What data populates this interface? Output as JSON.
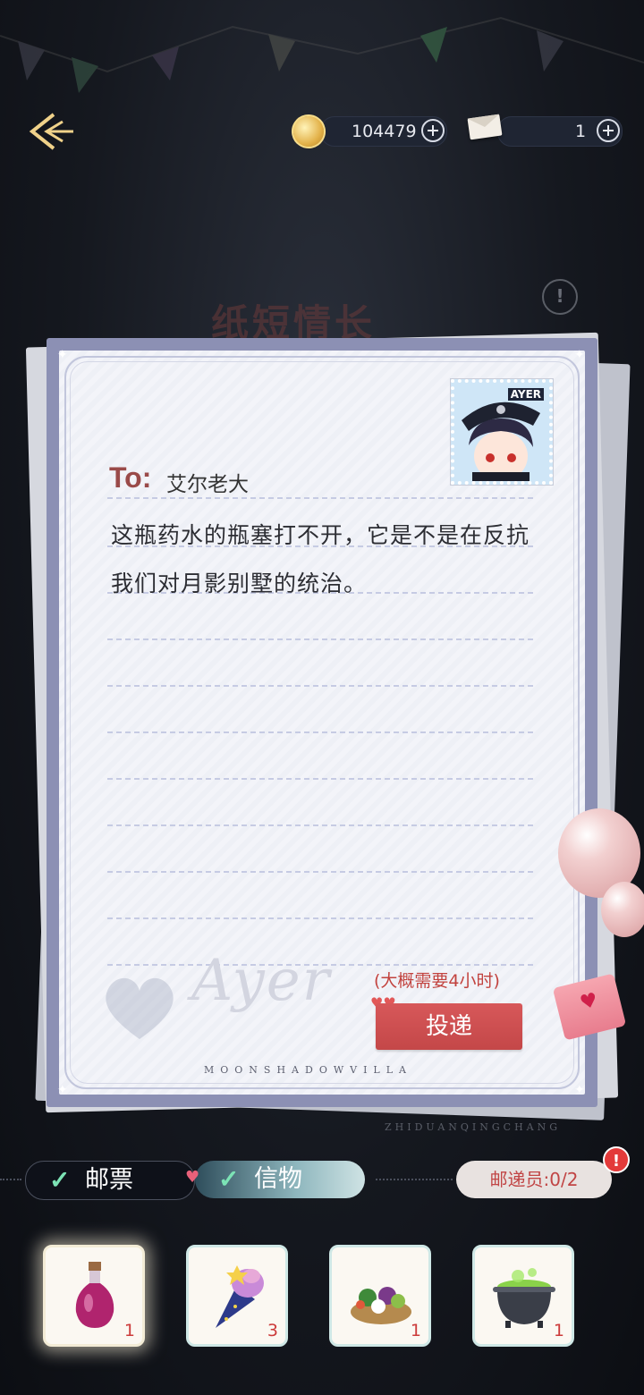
{
  "header": {
    "coins": "104479",
    "letters": "1"
  },
  "background": {
    "banner_title": "纸短情长",
    "subtitle": "ZHIDUANQINGCHANG"
  },
  "letter": {
    "to_label": "To:",
    "recipient": "艾尔老大",
    "body_line1": "这瓶药水的瓶塞打不开，它是不是在反抗",
    "body_line2": "我们对月影别墅的统治。",
    "stamp_label": "AYER",
    "signature": "Ayer",
    "eta": "(大概需要4小时)",
    "send_label": "投递",
    "footer": "MOONSHADOWVILLA"
  },
  "tabs": {
    "stamp_label": "邮票",
    "gift_label": "信物"
  },
  "courier": {
    "label": "邮递员:0/2",
    "badge": "!"
  },
  "items": [
    {
      "name": "potion",
      "qty": "1"
    },
    {
      "name": "ice-cream-cone",
      "qty": "3"
    },
    {
      "name": "vegetable-plate",
      "qty": "1"
    },
    {
      "name": "cauldron",
      "qty": "1"
    }
  ],
  "colors": {
    "send_button": "#c44748",
    "to_label": "#9a4a49",
    "card_border": "#8c90b4"
  }
}
